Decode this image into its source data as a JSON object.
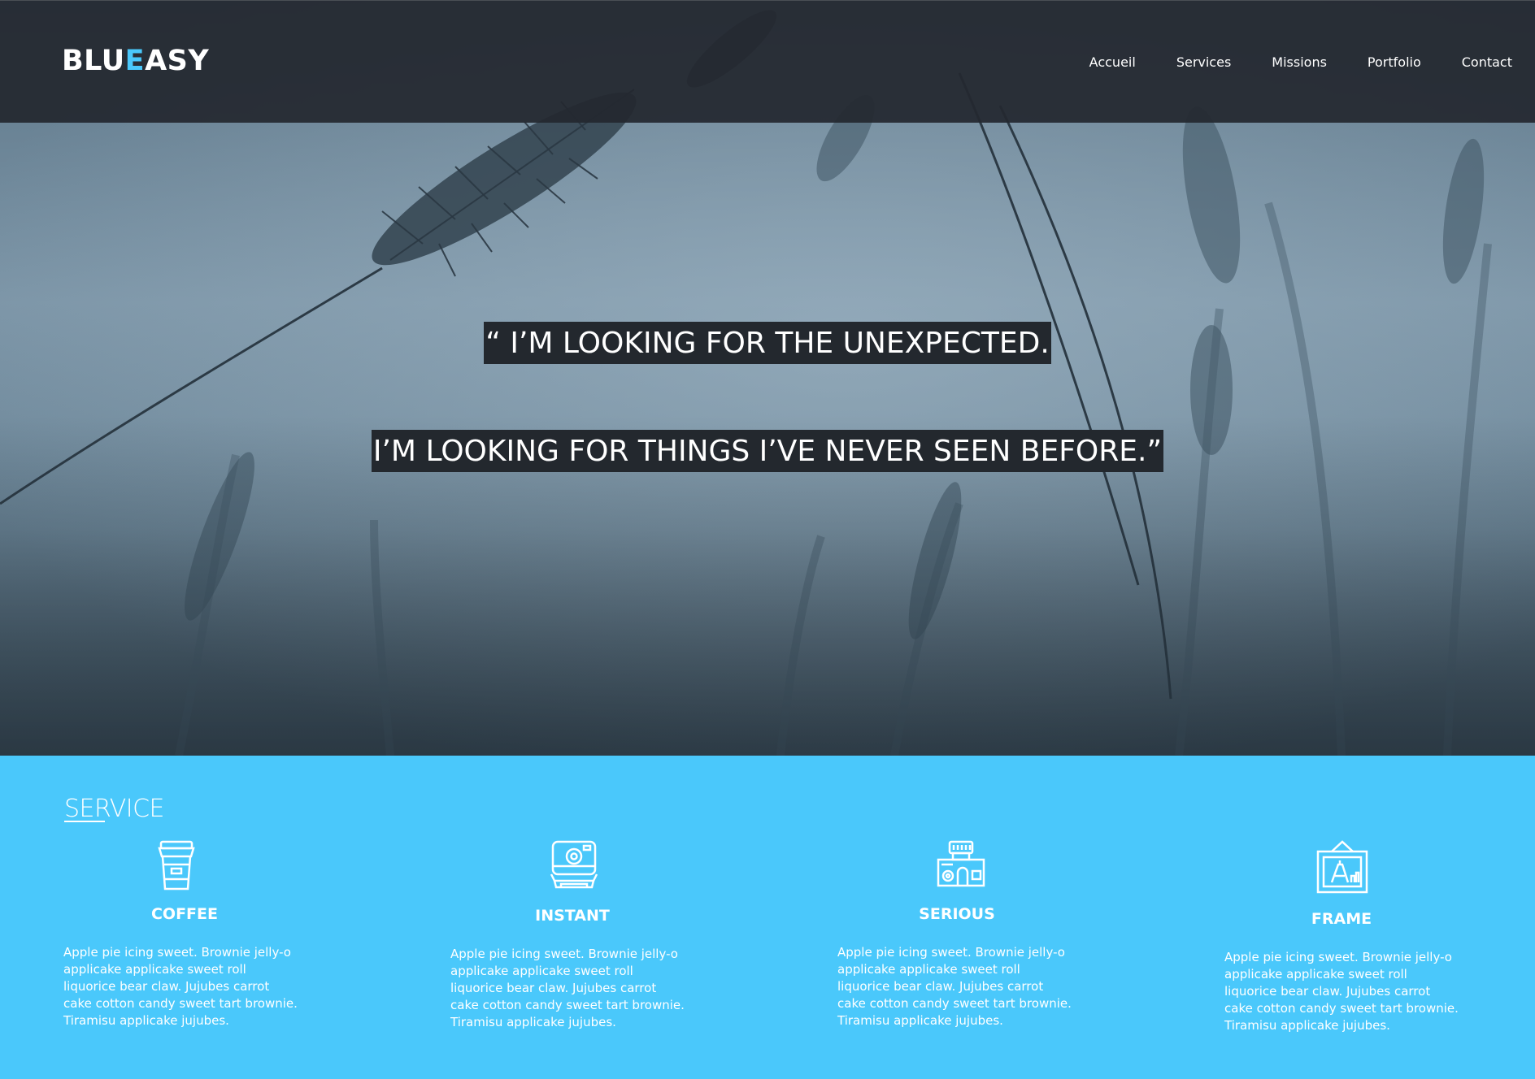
{
  "brand": {
    "part1": "BLU",
    "part2": "E",
    "part3": "ASY",
    "accent_color": "#4ac8fb"
  },
  "nav": {
    "items": [
      "Accueil",
      "Services",
      "Missions",
      "Portfolio",
      "Contact"
    ]
  },
  "hero": {
    "quote_line1": "“ I’M LOOKING FOR THE UNEXPECTED.",
    "quote_line2": "I’M LOOKING FOR THINGS I’VE NEVER SEEN BEFORE.”"
  },
  "services": {
    "title": "SERVICE",
    "background_color": "#4ac8fb",
    "items": [
      {
        "icon": "coffee-cup-icon",
        "title": "COFFEE",
        "text": "Apple pie icing sweet. Brownie jelly-o applicake applicake sweet roll liquorice bear claw. Jujubes carrot cake cotton candy sweet tart brownie. Tiramisu applicake jujubes."
      },
      {
        "icon": "instant-camera-icon",
        "title": "INSTANT",
        "text": "Apple pie icing sweet. Brownie jelly-o applicake applicake sweet roll liquorice bear claw. Jujubes carrot cake cotton candy sweet tart brownie. Tiramisu applicake jujubes."
      },
      {
        "icon": "vintage-camera-icon",
        "title": "SERIOUS",
        "text": "Apple pie icing sweet. Brownie jelly-o applicake applicake sweet roll liquorice bear claw. Jujubes carrot cake cotton candy sweet tart brownie. Tiramisu applicake jujubes."
      },
      {
        "icon": "picture-frame-icon",
        "title": "FRAME",
        "text": "Apple pie icing sweet. Brownie jelly-o applicake applicake sweet roll liquorice bear claw. Jujubes carrot cake cotton candy sweet tart brownie. Tiramisu applicake jujubes."
      }
    ]
  }
}
